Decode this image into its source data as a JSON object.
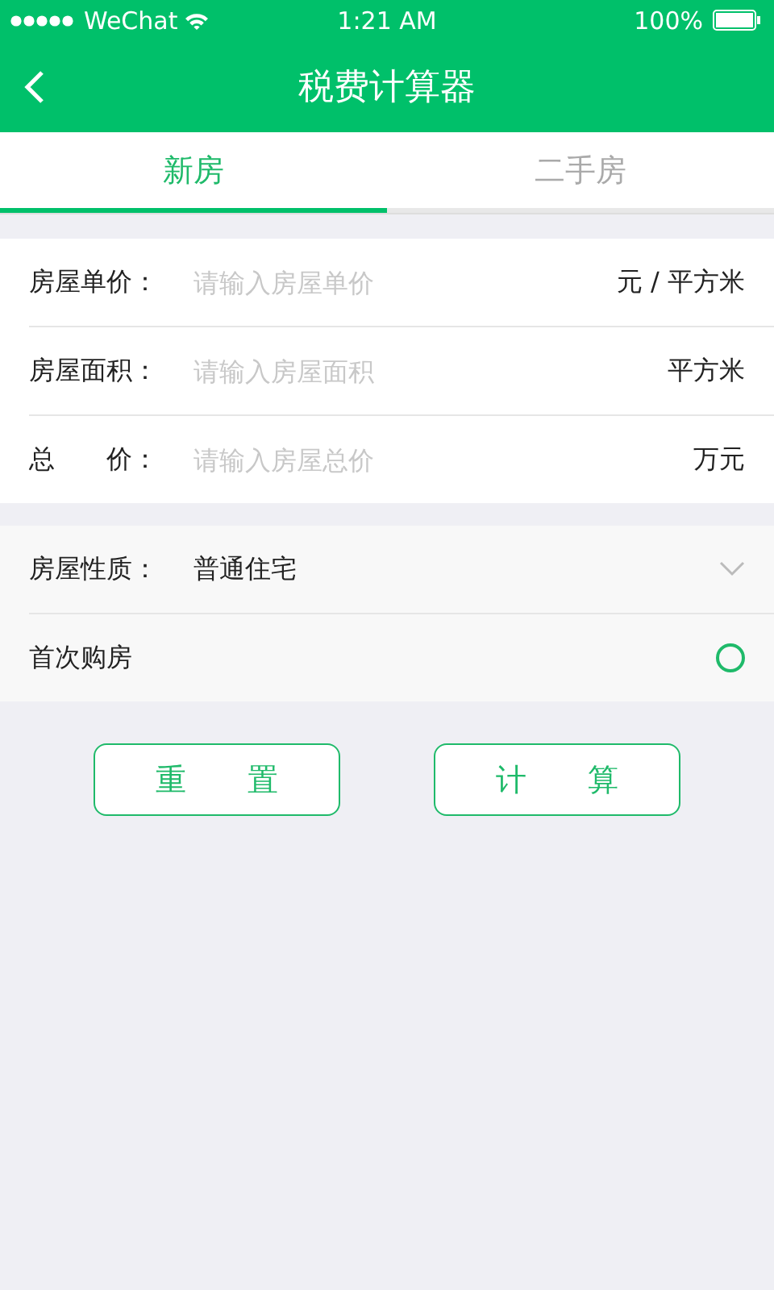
{
  "status_bar": {
    "carrier": "WeChat",
    "time": "1:21 AM",
    "battery": "100%"
  },
  "nav_bar": {
    "title": "税费计算器"
  },
  "tabs": [
    {
      "label": "新房",
      "selected": true
    },
    {
      "label": "二手房",
      "selected": false
    }
  ],
  "inputs": [
    {
      "label": "房屋单价：",
      "placeholder": "请输入房屋单价",
      "unit": "元 / 平方米"
    },
    {
      "label": "房屋面积：",
      "placeholder": "请输入房屋面积",
      "unit": "平方米"
    },
    {
      "label": "总　　价：",
      "placeholder": "请输入房屋总价",
      "unit": "万元"
    }
  ],
  "options": [
    {
      "kind": "select",
      "label": "房屋性质：",
      "value": "普通住宅"
    },
    {
      "kind": "radio",
      "label": "首次购房",
      "checked": false
    }
  ],
  "buttons": [
    "重　　置",
    "计　　算"
  ]
}
